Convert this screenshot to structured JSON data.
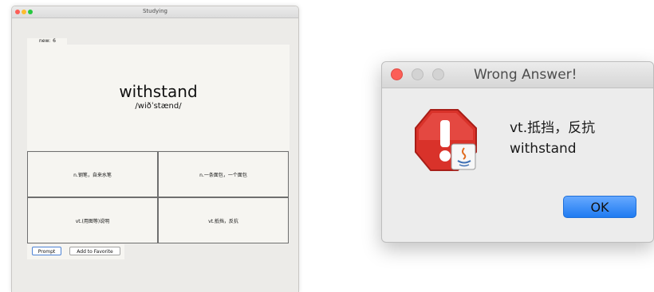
{
  "studying_window": {
    "title": "Studying",
    "new_label": "new:",
    "new_count": "6",
    "word": "withstand",
    "phonetic": "/wiðˈstænd/",
    "options": [
      "n.钢笔，自来水笔",
      "n.一条面包，一个面包",
      "vt.(用图等)说明",
      "vt.抵挡，反抗"
    ],
    "buttons": {
      "prompt": "Prompt",
      "favorite": "Add to Favorite"
    }
  },
  "dialog": {
    "title": "Wrong Answer!",
    "message_line1": "vt.抵挡，反抗",
    "message_line2": "withstand",
    "ok_label": "OK",
    "icon": "warning-java-icon"
  },
  "colors": {
    "close": "#fc5f57",
    "minimize": "#fdbc2e",
    "maximize": "#28c840",
    "ok_button": "#2f86f6",
    "error_red": "#d9322a"
  }
}
